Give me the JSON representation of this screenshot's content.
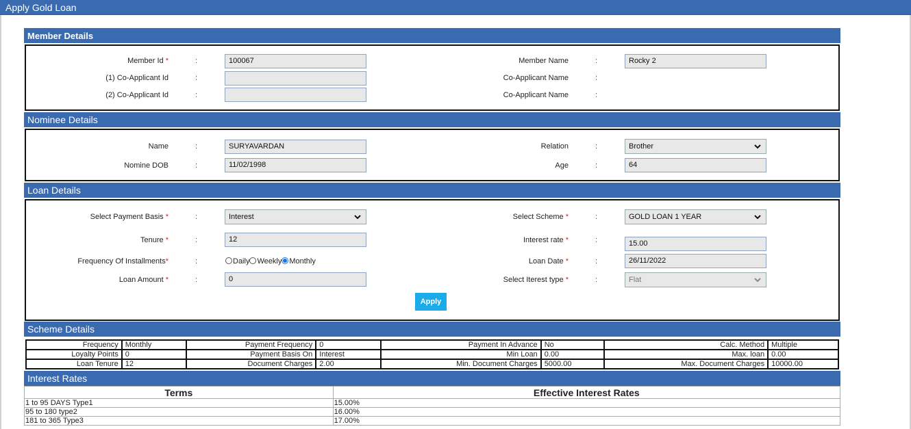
{
  "page": {
    "title": "Apply Gold Loan"
  },
  "member": {
    "section_title": "Member Details",
    "member_id_label": "Member Id",
    "member_id_value": "100067",
    "member_name_label": "Member Name",
    "member_name_value": "Rocky 2",
    "co1_label": "(1) Co-Applicant Id",
    "co1_value": "",
    "co1_name_label": "Co-Applicant Name",
    "co2_label": "(2) Co-Applicant Id",
    "co2_value": "",
    "co2_name_label": "Co-Applicant Name",
    "colon": ":",
    "required_mark": "*"
  },
  "nominee": {
    "section_title": "Nominee Details",
    "name_label": "Name",
    "name_value": "SURYAVARDAN",
    "relation_label": "Relation",
    "relation_value": "Brother",
    "dob_label": "Nomine DOB",
    "dob_value": "11/02/1998",
    "age_label": "Age",
    "age_value": "64"
  },
  "loan": {
    "section_title": "Loan Details",
    "payment_basis_label": "Select Payment Basis",
    "payment_basis_value": "Interest",
    "scheme_label": "Select Scheme",
    "scheme_value": "GOLD LOAN 1 YEAR",
    "tenure_label": "Tenure",
    "tenure_value": "12",
    "interest_rate_label": "Interest rate",
    "interest_rate_value": "15.00",
    "frequency_label": "Frequency Of Installments",
    "frequency_options": [
      "Daily",
      "Weekly",
      "Monthly"
    ],
    "frequency_selected": "Monthly",
    "loan_date_label": "Loan Date",
    "loan_date_value": "26/11/2022",
    "loan_amount_label": "Loan Amount",
    "loan_amount_value": "0",
    "interest_type_label": "Select Iterest type",
    "interest_type_value": "Flat",
    "apply_label": "Apply"
  },
  "scheme": {
    "section_title": "Scheme Details",
    "rows": [
      [
        {
          "k": "Frequency",
          "v": "Monthly"
        },
        {
          "k": "Payment Frequency",
          "v": "0"
        },
        {
          "k": "Payment In Advance",
          "v": "No"
        },
        {
          "k": "Calc. Method",
          "v": "Multiple"
        }
      ],
      [
        {
          "k": "Loyalty Points",
          "v": "0"
        },
        {
          "k": "Payment Basis On",
          "v": "Interest"
        },
        {
          "k": "Min Loan",
          "v": "0.00"
        },
        {
          "k": "Max. loan",
          "v": "0.00"
        }
      ],
      [
        {
          "k": "Loan Tenure",
          "v": "12"
        },
        {
          "k": "Document Charges",
          "v": "2.00"
        },
        {
          "k": "Min. Document Charges",
          "v": "5000.00"
        },
        {
          "k": "Max. Document Charges",
          "v": "10000.00"
        }
      ]
    ]
  },
  "rates": {
    "section_title": "Interest Rates",
    "headers": [
      "Terms",
      "Effective Interest Rates"
    ],
    "rows": [
      [
        "1 to 95 DAYS Type1",
        "15.00%"
      ],
      [
        "95 to 180 type2",
        "16.00%"
      ],
      [
        "181 to 365 Type3",
        "17.00%"
      ]
    ]
  },
  "colors": {
    "header_blue": "#3a6aaf",
    "button_blue": "#1aabe8",
    "required_red": "#e02020"
  }
}
